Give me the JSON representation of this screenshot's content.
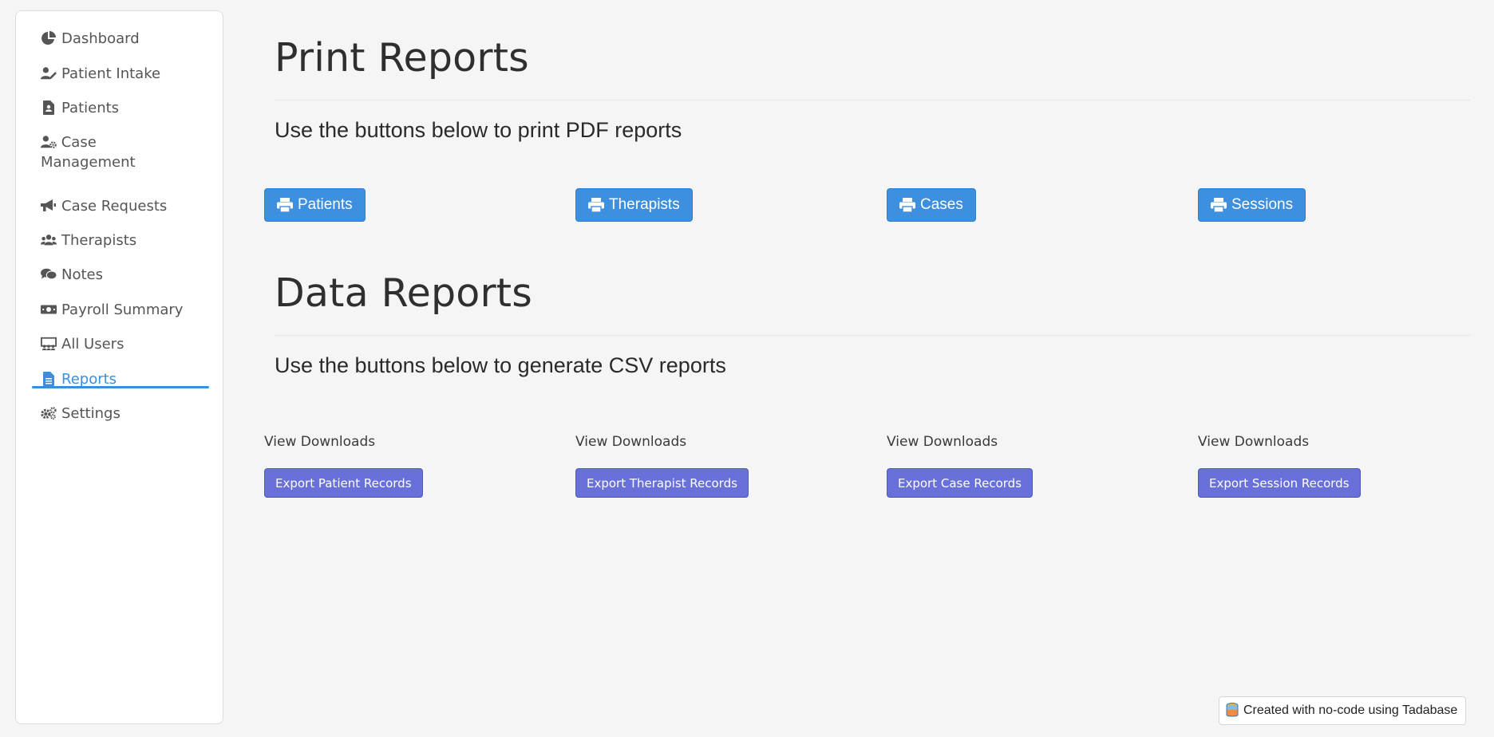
{
  "sidebar": {
    "items": [
      {
        "label": "Dashboard",
        "icon": "pie-chart-icon"
      },
      {
        "label": "Patient Intake",
        "icon": "user-edit-icon"
      },
      {
        "label": "Patients",
        "icon": "file-user-icon"
      },
      {
        "label": "Case",
        "label2": "Management",
        "icon": "user-gear-icon"
      },
      {
        "label": "Case Requests",
        "icon": "megaphone-icon"
      },
      {
        "label": "Therapists",
        "icon": "users-icon"
      },
      {
        "label": "Notes",
        "icon": "comments-icon"
      },
      {
        "label": "Payroll Summary",
        "icon": "money-bill-icon"
      },
      {
        "label": "All Users",
        "icon": "chalkboard-user-icon"
      },
      {
        "label": "Reports",
        "icon": "file-text-icon",
        "active": true
      },
      {
        "label": "Settings",
        "icon": "gears-icon"
      }
    ]
  },
  "print_section": {
    "title": "Print Reports",
    "subtitle": "Use the buttons below to print PDF reports",
    "buttons": [
      "Patients",
      "Therapists",
      "Cases",
      "Sessions"
    ]
  },
  "data_section": {
    "title": "Data Reports",
    "subtitle": "Use the buttons below to generate CSV reports",
    "view_label": "View Downloads",
    "exports": [
      "Export Patient Records",
      "Export Therapist Records",
      "Export Case Records",
      "Export Session Records"
    ]
  },
  "footer": {
    "badge_text": "Created with no-code using Tadabase"
  },
  "colors": {
    "accent": "#3a8ee0",
    "print_button": "#3d8fe0",
    "export_button": "#6870da"
  }
}
